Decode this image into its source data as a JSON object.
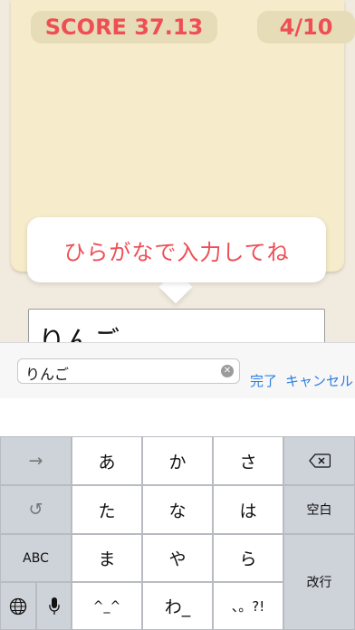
{
  "header": {
    "score": "SCORE 37.13",
    "progress": "4/10"
  },
  "prompt": {
    "text": "ひらがなで入力してね"
  },
  "answer": {
    "value": "りんご"
  },
  "ime": {
    "input_value": "りんご",
    "done_label": "完了",
    "cancel_label": "キャンセル"
  },
  "keyboard": {
    "right_next": "→",
    "undo": "↺",
    "abc": "ABC",
    "globe": "globe-icon",
    "mic": "mic-icon",
    "backspace": "backspace-icon",
    "space": "空白",
    "return": "改行",
    "keys": [
      "あ",
      "か",
      "さ",
      "た",
      "な",
      "は",
      "ま",
      "や",
      "ら",
      "^_^",
      "わ_",
      "、。?!"
    ]
  },
  "colors": {
    "accent": "#ee4e54",
    "link": "#2c7fe0",
    "card": "#f6ebcb"
  }
}
